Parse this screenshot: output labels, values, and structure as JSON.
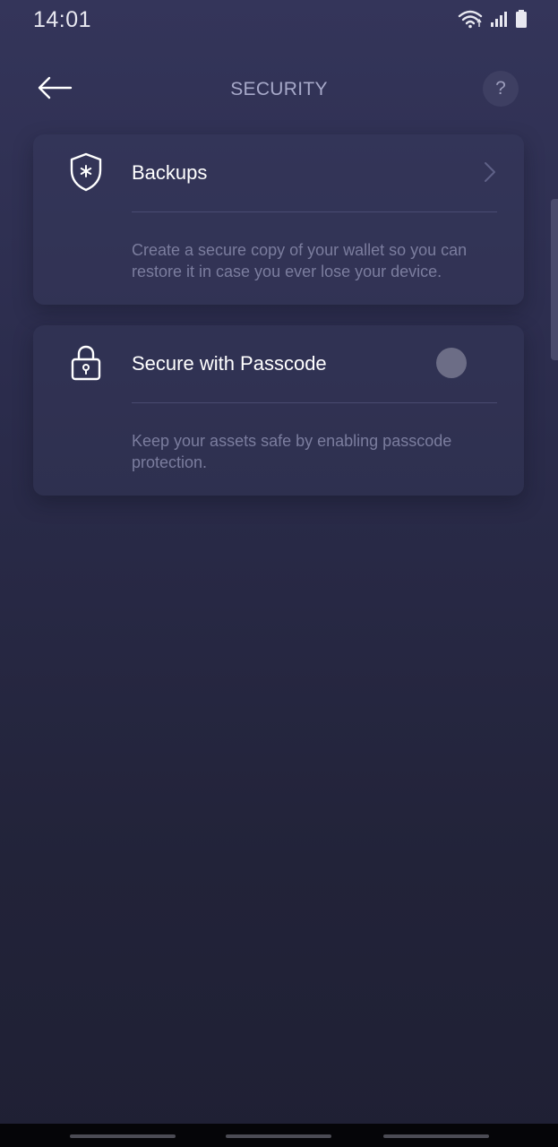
{
  "status_bar": {
    "time": "14:01",
    "icons": [
      "wifi-icon",
      "signal-icon",
      "battery-icon"
    ]
  },
  "header": {
    "title": "SECURITY",
    "back_icon": "arrow-left-icon",
    "help_label": "?"
  },
  "cards": [
    {
      "title": "Backups",
      "icon": "shield-icon",
      "description": "Create a secure copy of your wallet so you can restore it in case you ever lose your device.",
      "action": "chevron-right-icon"
    },
    {
      "title": "Secure with Passcode",
      "icon": "lock-icon",
      "description": "Keep your assets safe by enabling passcode protection.",
      "toggle_on": false
    }
  ],
  "colors": {
    "background_top": "#34355a",
    "background_bottom": "#1f2034",
    "title_text": "#a7a9c9",
    "description_text": "#7b7d9e",
    "toggle_knob": "#6c6d86"
  }
}
